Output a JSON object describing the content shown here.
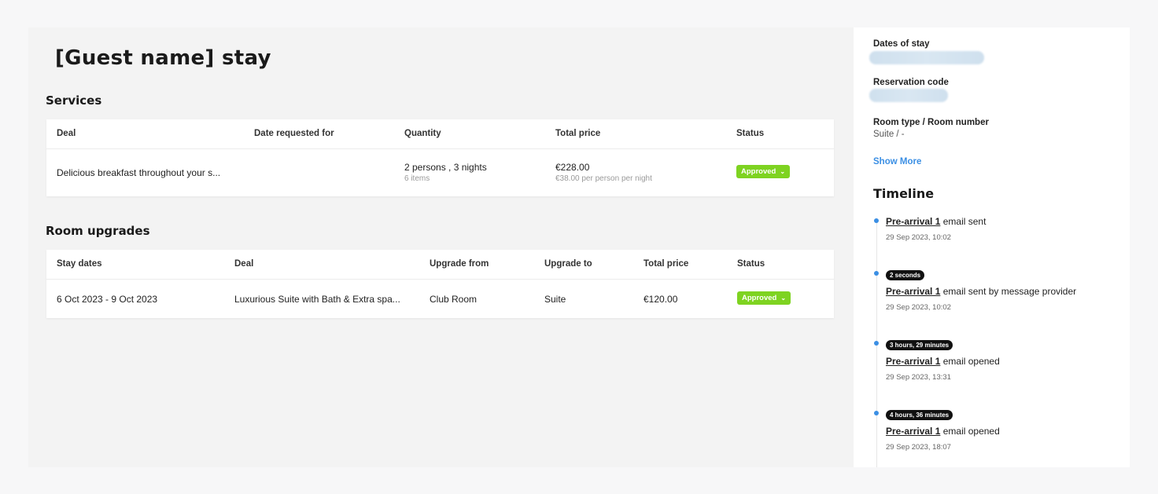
{
  "page": {
    "title": "[Guest name] stay"
  },
  "services": {
    "section_title": "Services",
    "columns": [
      "Deal",
      "Date requested for",
      "Quantity",
      "Total price",
      "Status"
    ],
    "rows": [
      {
        "deal": "Delicious breakfast throughout your s...",
        "date_requested": "",
        "quantity": "2 persons , 3 nights",
        "quantity_sub": "6 items",
        "total": "€228.00",
        "total_sub": "€38.00 per person per night",
        "status": "Approved"
      }
    ]
  },
  "room_upgrades": {
    "section_title": "Room upgrades",
    "columns": [
      "Stay dates",
      "Deal",
      "Upgrade from",
      "Upgrade to",
      "Total price",
      "Status"
    ],
    "rows": [
      {
        "stay_dates": "6 Oct 2023 - 9 Oct 2023",
        "deal": "Luxurious Suite with Bath & Extra spa...",
        "upgrade_from": "Club Room",
        "upgrade_to": "Suite",
        "total": "€120.00",
        "status": "Approved"
      }
    ]
  },
  "sidebar": {
    "dates_label": "Dates of stay",
    "reservation_label": "Reservation code",
    "room_label": "Room type / Room number",
    "room_value": "Suite / -",
    "show_more": "Show More",
    "timeline_title": "Timeline",
    "events": [
      {
        "pill": "",
        "link": "Pre-arrival 1",
        "text": " email sent",
        "time": "29 Sep 2023, 10:02"
      },
      {
        "pill": "2 seconds",
        "link": "Pre-arrival 1",
        "text": " email sent by message provider",
        "time": "29 Sep 2023, 10:02"
      },
      {
        "pill": "3 hours, 29 minutes",
        "link": "Pre-arrival 1",
        "text": " email opened",
        "time": "29 Sep 2023, 13:31"
      },
      {
        "pill": "4 hours, 36 minutes",
        "link": "Pre-arrival 1",
        "text": " email opened",
        "time": "29 Sep 2023, 18:07"
      }
    ]
  },
  "colors": {
    "accent": "#3b8fe4",
    "approved": "#7ed321"
  },
  "icons": {
    "status_dropdown": "chevron-down-icon"
  }
}
